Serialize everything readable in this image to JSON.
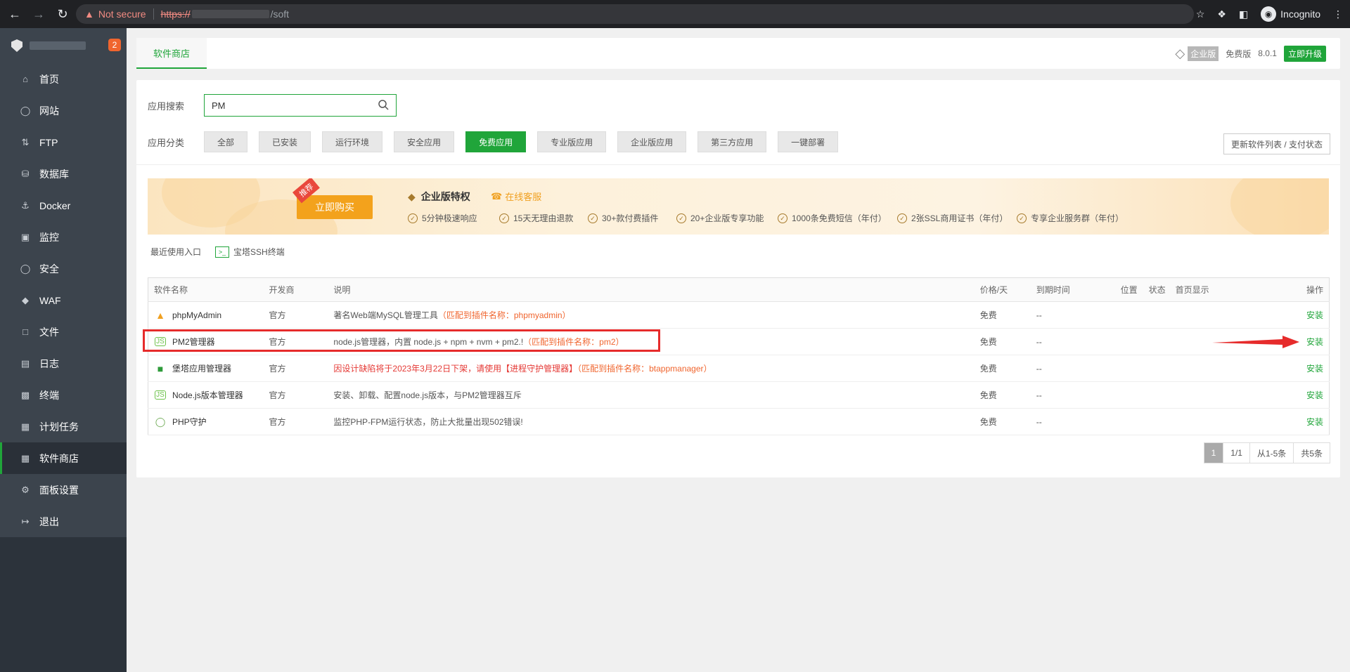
{
  "browser": {
    "not_secure": "Not secure",
    "url_protocol": "https://",
    "url_path": "/soft",
    "incognito_label": "Incognito"
  },
  "sidebar": {
    "badge": "2",
    "items": [
      {
        "label": "首页",
        "icon": "home-icon"
      },
      {
        "label": "网站",
        "icon": "globe-icon"
      },
      {
        "label": "FTP",
        "icon": "ftp-icon"
      },
      {
        "label": "数据库",
        "icon": "database-icon"
      },
      {
        "label": "Docker",
        "icon": "docker-icon"
      },
      {
        "label": "监控",
        "icon": "monitor-icon"
      },
      {
        "label": "安全",
        "icon": "shield-icon"
      },
      {
        "label": "WAF",
        "icon": "waf-icon"
      },
      {
        "label": "文件",
        "icon": "folder-icon"
      },
      {
        "label": "日志",
        "icon": "log-icon"
      },
      {
        "label": "终端",
        "icon": "terminal-icon"
      },
      {
        "label": "计划任务",
        "icon": "calendar-icon"
      },
      {
        "label": "软件商店",
        "icon": "grid-icon"
      },
      {
        "label": "面板设置",
        "icon": "gear-icon"
      },
      {
        "label": "退出",
        "icon": "logout-icon"
      }
    ]
  },
  "topbar": {
    "tab": "软件商店",
    "enterprise": "企业版",
    "free": "免费版",
    "version": "8.0.1",
    "upgrade": "立即升级"
  },
  "search": {
    "label": "应用搜索",
    "value": "PM"
  },
  "categories": {
    "label": "应用分类",
    "items": [
      "全部",
      "已安装",
      "运行环境",
      "安全应用",
      "免费应用",
      "专业版应用",
      "企业版应用",
      "第三方应用",
      "一键部署"
    ],
    "active": "免费应用",
    "refresh": "更新软件列表 / 支付状态"
  },
  "promo": {
    "recommend": "推荐",
    "buy": "立即购买",
    "title": "企业版特权",
    "service": "在线客服",
    "features": [
      "5分钟极速响应",
      "15天无理由退款",
      "30+款付费插件",
      "20+企业版专享功能",
      "1000条免费短信（年付）",
      "2张SSL商用证书（年付）",
      "专享企业服务群（年付）"
    ]
  },
  "recent": {
    "label": "最近使用入口",
    "item": "宝塔SSH终端"
  },
  "table": {
    "headers": [
      "软件名称",
      "开发商",
      "说明",
      "价格/天",
      "到期时间",
      "位置",
      "状态",
      "首页显示",
      "操作"
    ],
    "rows": [
      {
        "name": "phpMyAdmin",
        "dev": "官方",
        "desc": "著名Web端MySQL管理工具",
        "match": "（匹配到插件名称：phpmyadmin）",
        "price": "免费",
        "expire": "--",
        "action": "安装"
      },
      {
        "name": "PM2管理器",
        "dev": "官方",
        "desc": "node.js管理器，内置 node.js + npm + nvm + pm2.!",
        "match": "（匹配到插件名称：pm2）",
        "price": "免费",
        "expire": "--",
        "action": "安装"
      },
      {
        "name": "堡塔应用管理器",
        "dev": "官方",
        "desc": "因设计缺陷将于2023年3月22日下架，请使用【进程守护管理器】",
        "match": "（匹配到插件名称：btappmanager）",
        "price": "免费",
        "expire": "--",
        "action": "安装"
      },
      {
        "name": "Node.js版本管理器",
        "dev": "官方",
        "desc": "安装、卸载、配置node.js版本，与PM2管理器互斥",
        "match": "",
        "price": "免费",
        "expire": "--",
        "action": "安装"
      },
      {
        "name": "PHP守护",
        "dev": "官方",
        "desc": "监控PHP-FPM运行状态，防止大批量出现502错误!",
        "match": "",
        "price": "免费",
        "expire": "--",
        "action": "安装"
      }
    ]
  },
  "pager": {
    "current": "1",
    "pages": "1/1",
    "range": "从1-5条",
    "total": "共5条"
  },
  "colors": {
    "accent": "#20a53a",
    "sidebar": "#3c444d",
    "highlight": "#e62b2b",
    "match": "#f0652e"
  }
}
